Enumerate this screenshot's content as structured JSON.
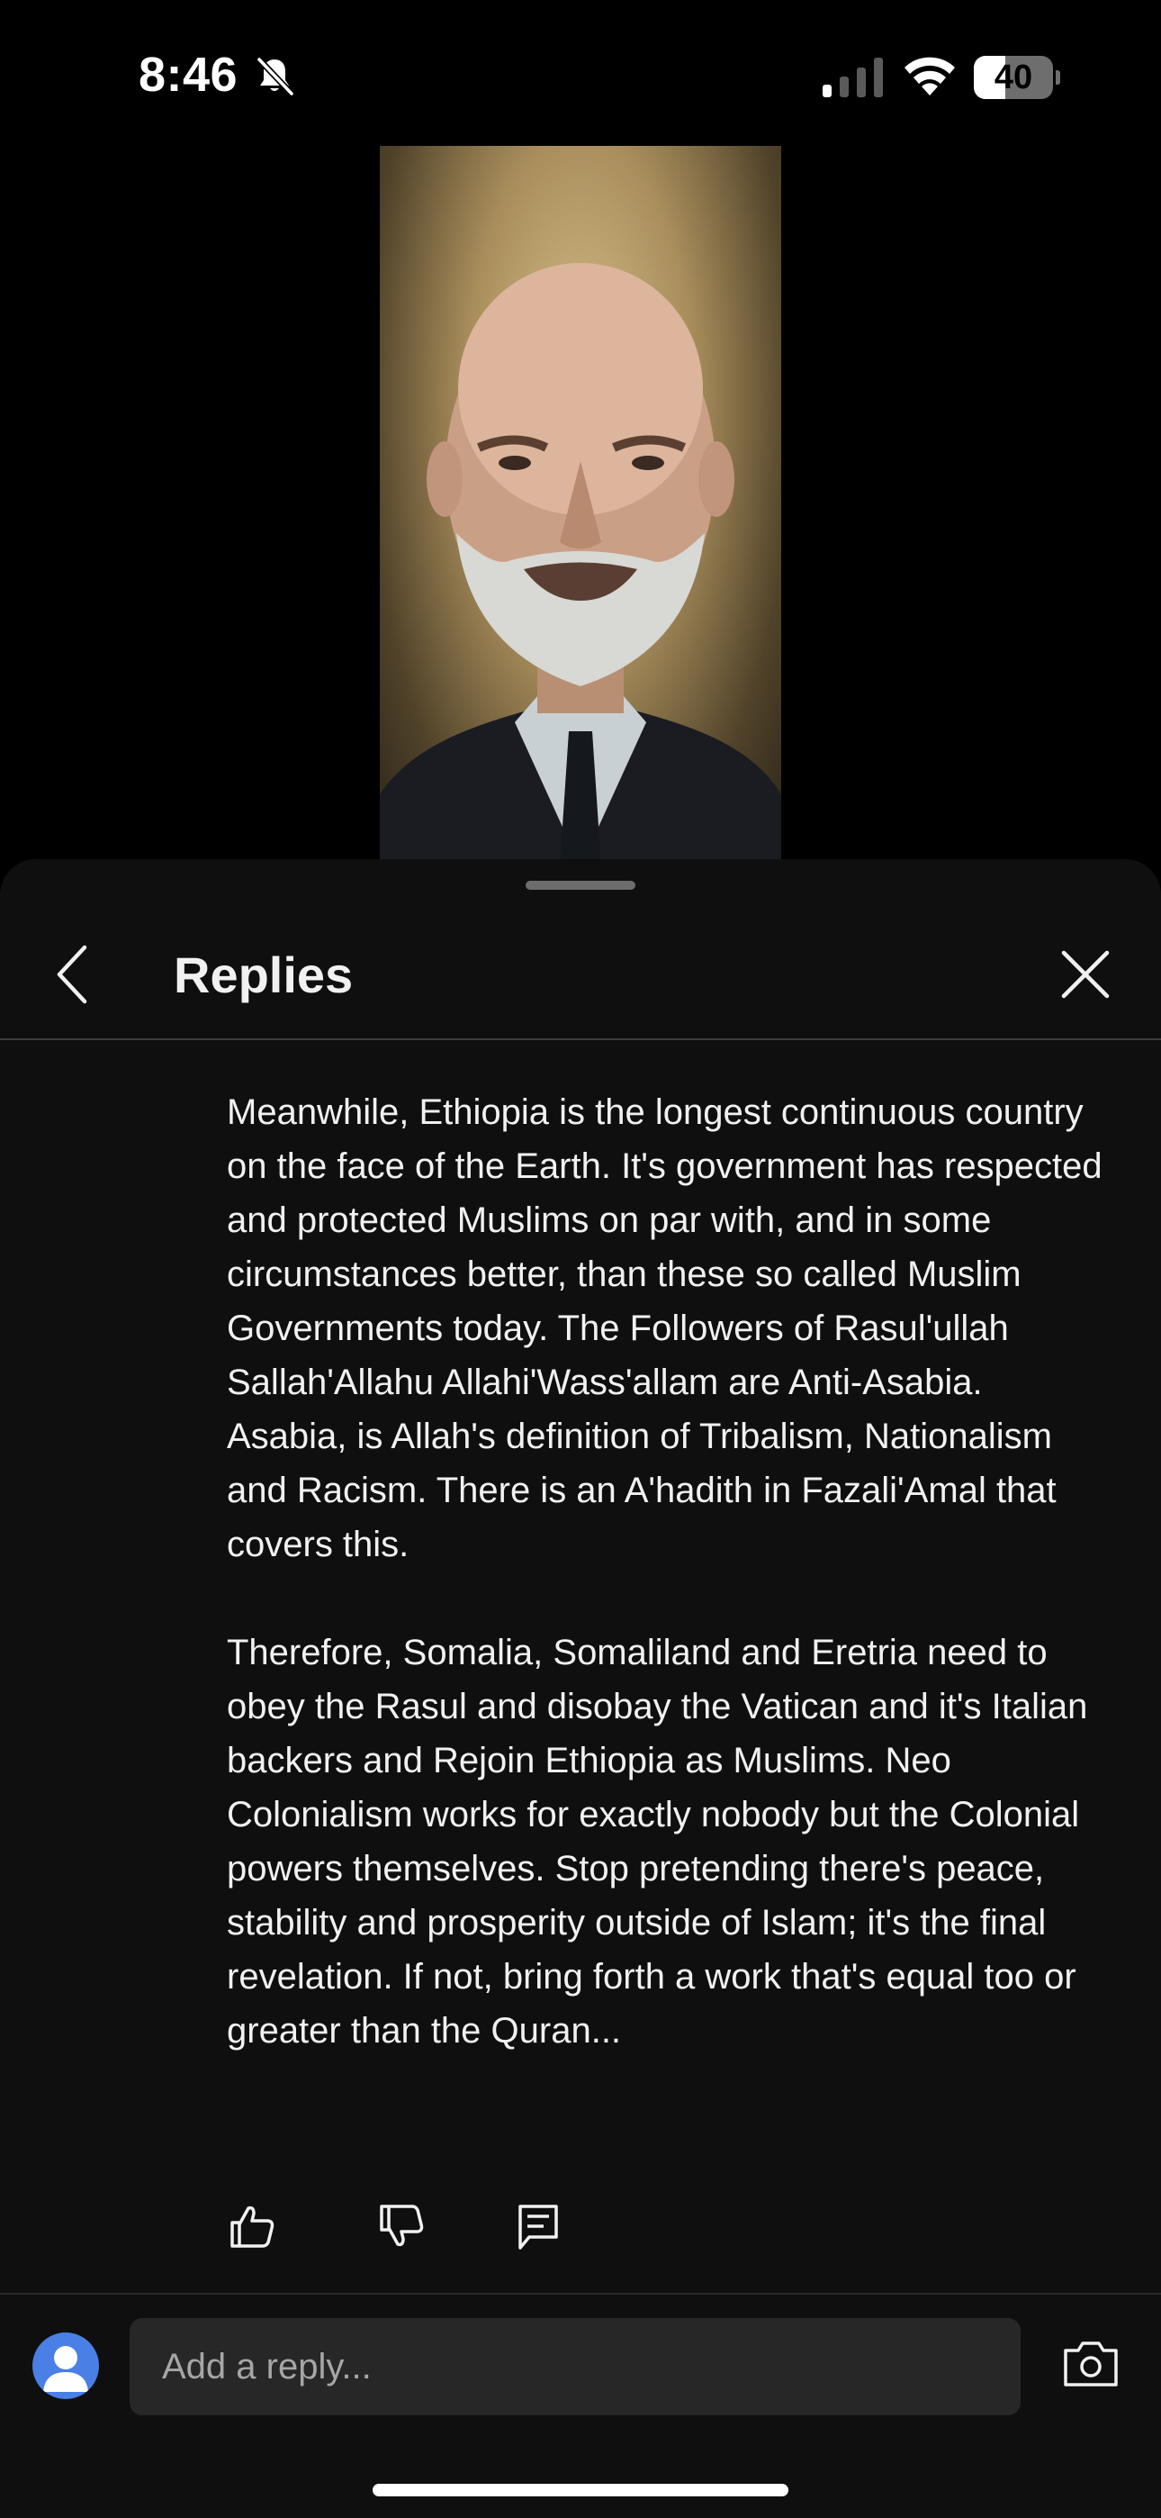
{
  "status_bar": {
    "time": "8:46",
    "silent_icon": "bell-slash-icon",
    "signal_icon": "cellular-signal-icon",
    "wifi_icon": "wifi-icon",
    "battery_level": "40",
    "battery_fraction": 0.4
  },
  "video": {
    "description_icon": "video-frame"
  },
  "replies_panel": {
    "title": "Replies",
    "back_icon": "chevron-left-icon",
    "close_icon": "close-icon"
  },
  "comment": {
    "paragraphs": [
      "Meanwhile, Ethiopia is the longest continuous country on the face of the Earth. It's government has respected and protected Muslims on par with, and in some circumstances better, than these so called Muslim Governments today. The Followers of Rasul'ullah Sallah'Allahu Allahi'Wass'allam are Anti-Asabia. Asabia, is Allah's definition of Tribalism, Nationalism and Racism. There is an A'hadith in Fazali'Amal that covers this.",
      "Therefore, Somalia, Somaliland and Eretria need to obey the Rasul and disobay the Vatican and it's Italian backers and Rejoin Ethiopia as Muslims. Neo Colonialism works for exactly nobody but the Colonial powers themselves. Stop pretending there's peace, stability and prosperity outside of Islam; it's the final revelation. If not, bring forth a work that's equal too or greater than the Quran..."
    ],
    "actions": [
      "thumbs-up-icon",
      "thumbs-down-icon",
      "reply-icon"
    ]
  },
  "reply_bar": {
    "placeholder": "Add a reply...",
    "avatar_icon": "default-avatar-icon",
    "camera_icon": "camera-icon"
  },
  "colors": {
    "background": "#000000",
    "sheet": "#0f0f0f",
    "input": "#272727",
    "avatar": "#4a7fe6"
  }
}
